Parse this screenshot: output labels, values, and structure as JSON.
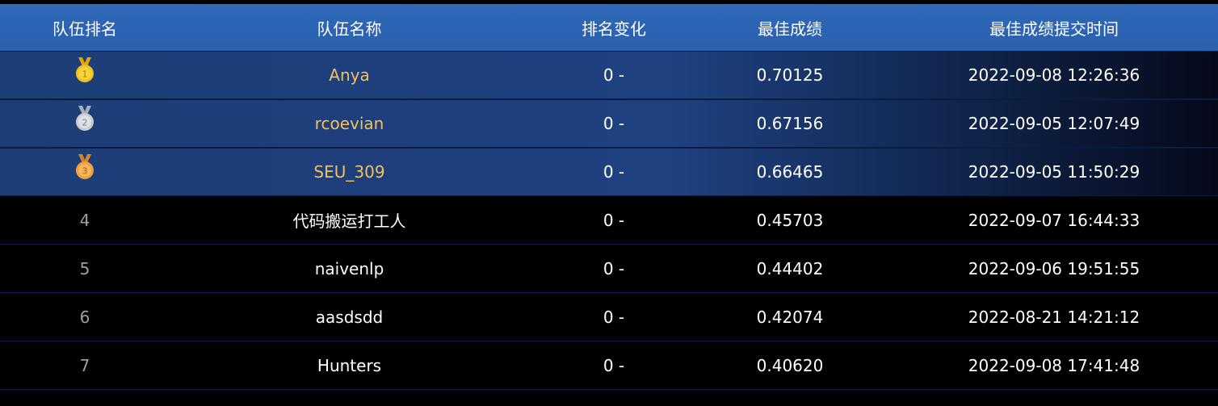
{
  "header": {
    "rank": "队伍排名",
    "team": "队伍名称",
    "change": "排名变化",
    "score": "最佳成绩",
    "time": "最佳成绩提交时间"
  },
  "colors": {
    "gold": "#f2c21a",
    "silver": "#c9cdd2",
    "bronze": "#f0a040",
    "team_highlight": "#f0c15a",
    "header_bg": "#2c63b3"
  },
  "rows": [
    {
      "rank": "1",
      "medal": "gold-medal-icon",
      "team": "Anya",
      "change": "0 -",
      "score": "0.70125",
      "time": "2022-09-08 12:26:36"
    },
    {
      "rank": "2",
      "medal": "silver-medal-icon",
      "team": "rcoevian",
      "change": "0 -",
      "score": "0.67156",
      "time": "2022-09-05 12:07:49"
    },
    {
      "rank": "3",
      "medal": "bronze-medal-icon",
      "team": "SEU_309",
      "change": "0 -",
      "score": "0.66465",
      "time": "2022-09-05 11:50:29"
    },
    {
      "rank": "4",
      "team": "代码搬运打工人",
      "change": "0 -",
      "score": "0.45703",
      "time": "2022-09-07 16:44:33"
    },
    {
      "rank": "5",
      "team": "naivenlp",
      "change": "0 -",
      "score": "0.44402",
      "time": "2022-09-06 19:51:55"
    },
    {
      "rank": "6",
      "team": "aasdsdd",
      "change": "0 -",
      "score": "0.42074",
      "time": "2022-08-21 14:21:12"
    },
    {
      "rank": "7",
      "team": "Hunters",
      "change": "0 -",
      "score": "0.40620",
      "time": "2022-09-08 17:41:48"
    }
  ]
}
